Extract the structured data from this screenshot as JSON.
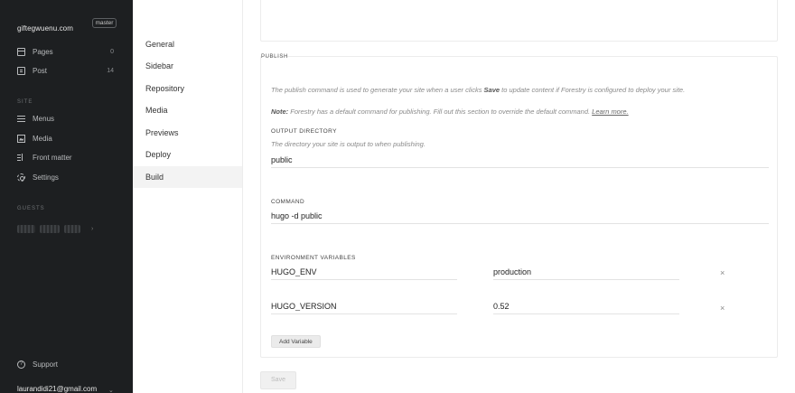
{
  "sidebar": {
    "site_name": "giftegwuenu.com",
    "branch": "master",
    "content_items": [
      {
        "label": "Pages",
        "count": "0"
      },
      {
        "label": "Post",
        "count": "14"
      }
    ],
    "site_section_label": "SITE",
    "site_items": [
      {
        "label": "Menus"
      },
      {
        "label": "Media"
      },
      {
        "label": "Front matter"
      },
      {
        "label": "Settings"
      }
    ],
    "guests_section_label": "GUESTS",
    "support_label": "Support",
    "user_email": "laurandidi21@gmail.com"
  },
  "subnav": {
    "items": [
      "General",
      "Sidebar",
      "Repository",
      "Media",
      "Previews",
      "Deploy",
      "Build"
    ],
    "active": "Build"
  },
  "publish": {
    "section_title": "PUBLISH",
    "description_pre": "The publish command is used to generate your site when a user clicks ",
    "description_bold": "Save",
    "description_post": " to update content if Forestry is configured to deploy your site.",
    "note_label": "Note:",
    "note_text": " Forestry has a default command for publishing. Fill out this section to override the default command. ",
    "learn_more": "Learn more.",
    "output_directory": {
      "label": "OUTPUT DIRECTORY",
      "hint": "The directory your site is output to when publishing.",
      "value": "public"
    },
    "command": {
      "label": "COMMAND",
      "value": "hugo -d public"
    },
    "env": {
      "label": "ENVIRONMENT VARIABLES",
      "variables": [
        {
          "key": "HUGO_ENV",
          "value": "production"
        },
        {
          "key": "HUGO_VERSION",
          "value": "0.52"
        }
      ],
      "remove_glyph": "×",
      "add_label": "Add Variable"
    },
    "save_label": "Save"
  }
}
